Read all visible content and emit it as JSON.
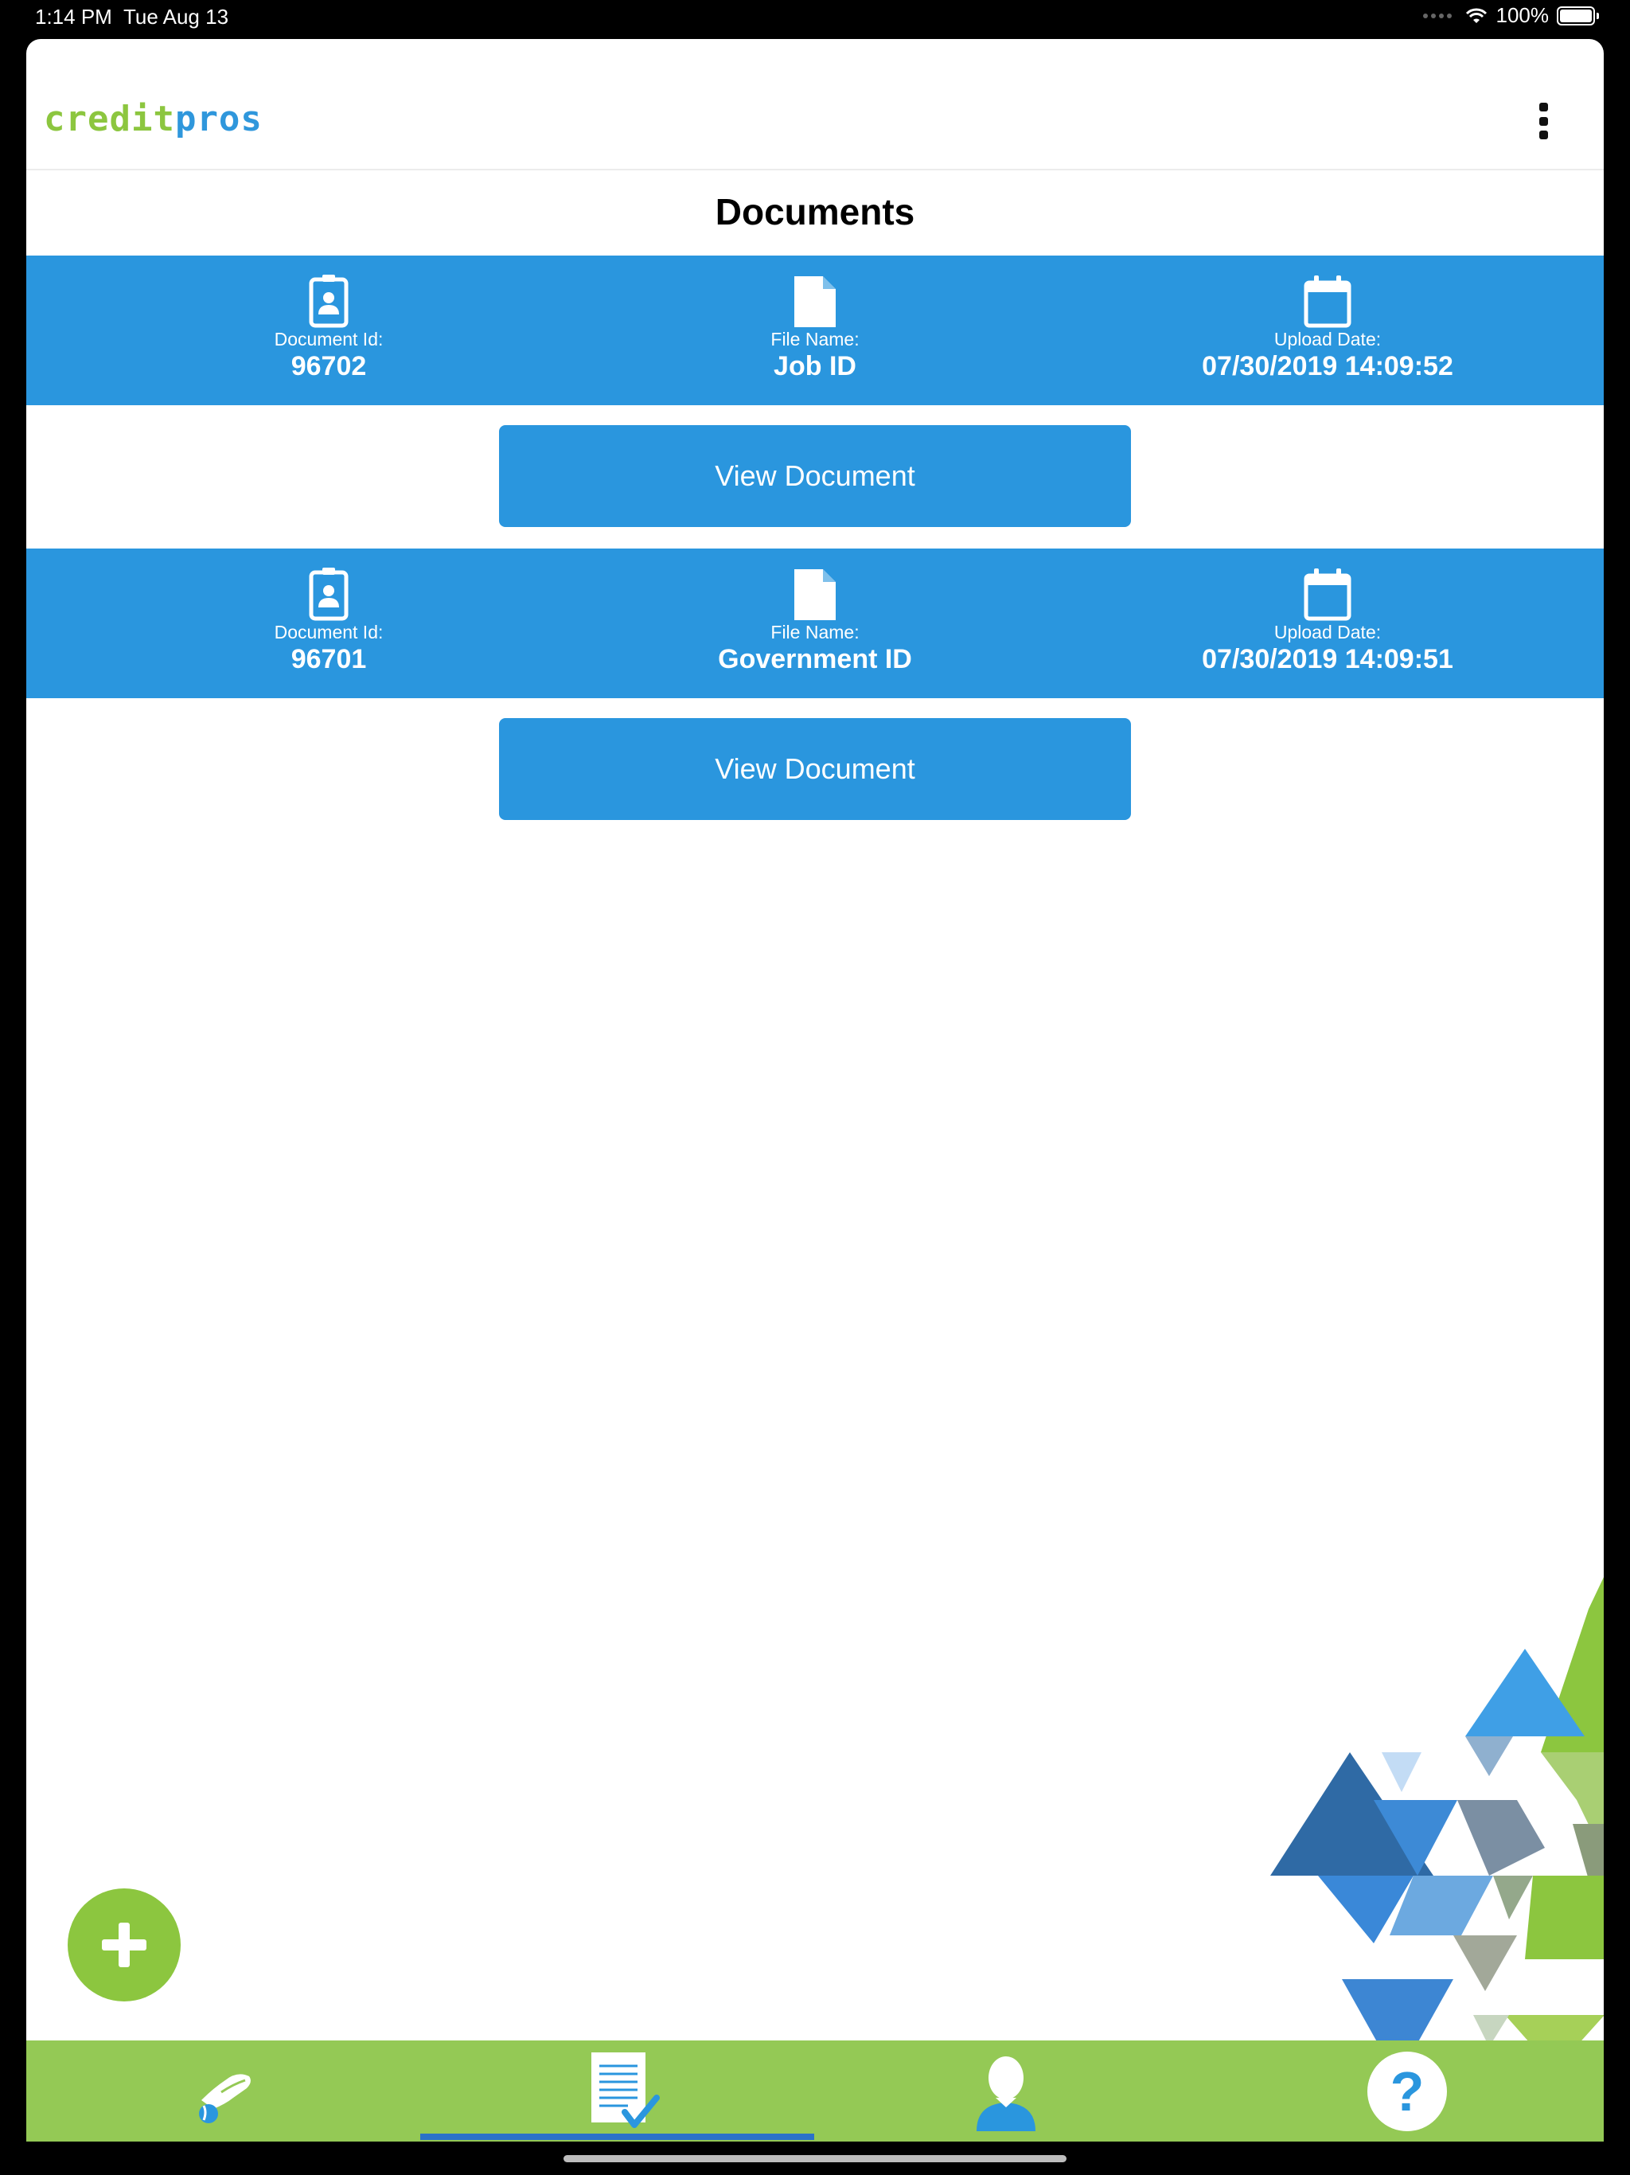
{
  "status_bar": {
    "time": "1:14 PM",
    "date": "Tue Aug 13",
    "battery": "100%"
  },
  "header": {
    "logo_part1": "credit",
    "logo_part2": "pros"
  },
  "page": {
    "title": "Documents"
  },
  "documents": [
    {
      "id_label": "Document Id:",
      "id": "96702",
      "file_label": "File Name:",
      "file": "Job ID",
      "date_label": "Upload Date:",
      "date": "07/30/2019 14:09:52",
      "button": "View Document"
    },
    {
      "id_label": "Document Id:",
      "id": "96701",
      "file_label": "File Name:",
      "file": "Government ID",
      "date_label": "Upload Date:",
      "date": "07/30/2019 14:09:51",
      "button": "View Document"
    }
  ],
  "tabbar": {
    "tabs": [
      {
        "icon": "hand-coin-icon"
      },
      {
        "icon": "document-check-icon",
        "selected": true
      },
      {
        "icon": "person-icon"
      },
      {
        "icon": "help-icon"
      }
    ]
  },
  "colors": {
    "brand_green": "#8cc63f",
    "brand_blue": "#2a96de",
    "tabbar": "#94c955"
  }
}
